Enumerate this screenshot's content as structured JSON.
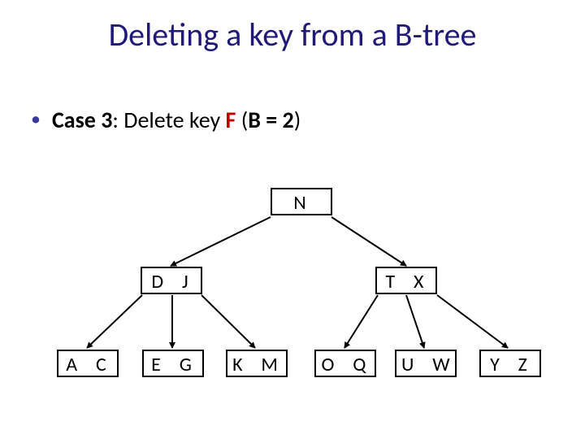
{
  "title": "Deleting a key from a B-tree",
  "bullet": {
    "case_label": "Case 3",
    "colon_delete": ": Delete key ",
    "key": "F",
    "space_paren": "  (",
    "b_eq": "B = 2",
    "close_paren": ")"
  },
  "tree": {
    "root": "N",
    "level1": {
      "left": "D  J",
      "right": "T  X"
    },
    "leaves": {
      "l0": "A  C",
      "l1": "E  G",
      "l2": "K  M",
      "l3": "O  Q",
      "l4": "U  W",
      "l5": "Y  Z"
    }
  }
}
